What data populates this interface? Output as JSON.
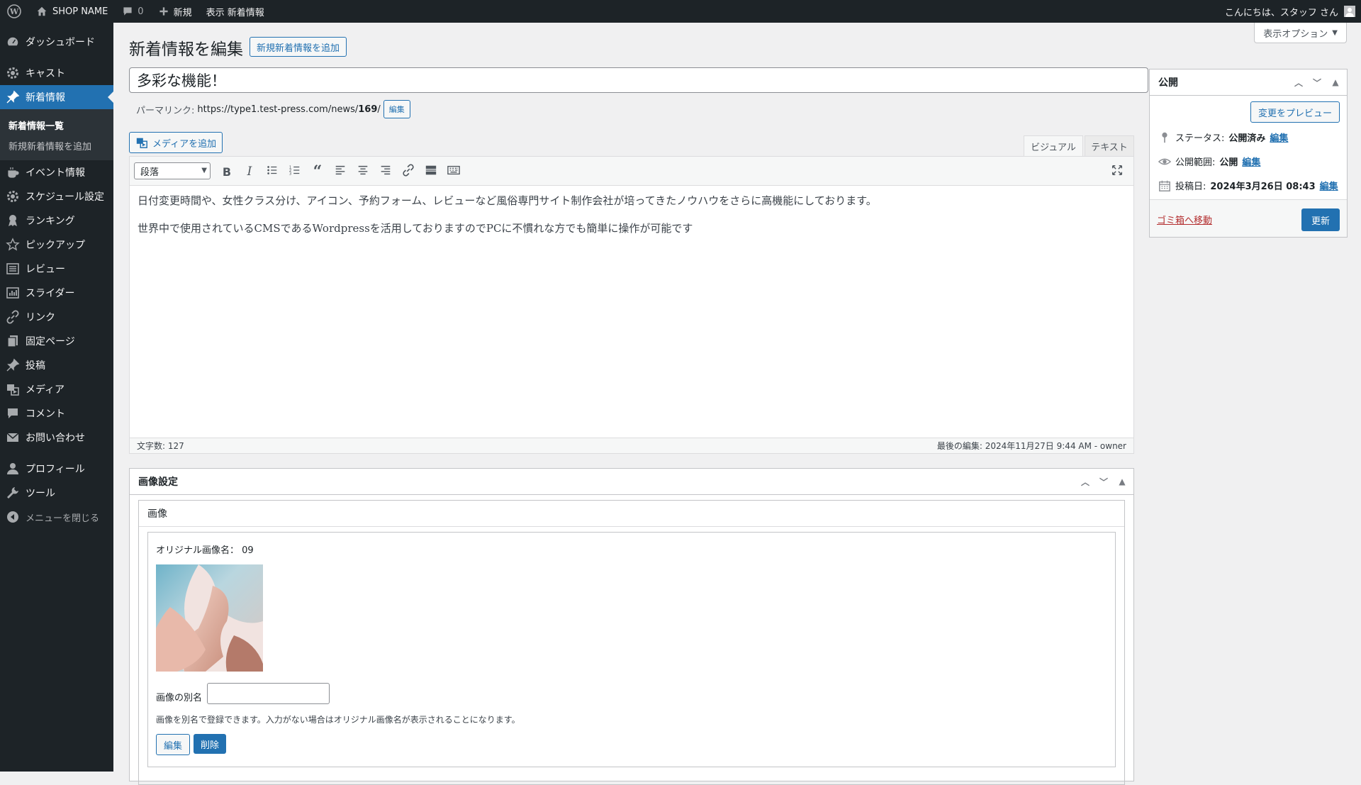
{
  "adminbar": {
    "site_name": "SHOP NAME",
    "comments_count": "0",
    "new_label": "新規",
    "view_label": "表示 新着情報",
    "greeting": "こんにちは、スタッフ さん"
  },
  "sidebar": {
    "items": [
      {
        "label": "ダッシュボード",
        "icon": "dashboard-icon"
      },
      {
        "label": "キャスト",
        "icon": "gear-icon"
      },
      {
        "label": "新着情報",
        "icon": "pin-icon"
      },
      {
        "label": "イベント情報",
        "icon": "coffee-icon"
      },
      {
        "label": "スケジュール設定",
        "icon": "gear-icon"
      },
      {
        "label": "ランキング",
        "icon": "award-icon"
      },
      {
        "label": "ピックアップ",
        "icon": "star-icon"
      },
      {
        "label": "レビュー",
        "icon": "list-icon"
      },
      {
        "label": "スライダー",
        "icon": "chart-icon"
      },
      {
        "label": "リンク",
        "icon": "link-icon"
      },
      {
        "label": "固定ページ",
        "icon": "page-icon"
      },
      {
        "label": "投稿",
        "icon": "pin-icon"
      },
      {
        "label": "メディア",
        "icon": "media-icon"
      },
      {
        "label": "コメント",
        "icon": "comment-icon"
      },
      {
        "label": "お問い合わせ",
        "icon": "mail-icon"
      },
      {
        "label": "プロフィール",
        "icon": "user-icon"
      },
      {
        "label": "ツール",
        "icon": "wrench-icon"
      }
    ],
    "submenu": [
      "新着情報一覧",
      "新規新着情報を追加"
    ],
    "collapse_label": "メニューを閉じる"
  },
  "screen_options": "表示オプション",
  "page": {
    "title": "新着情報を編集",
    "add_new": "新規新着情報を追加"
  },
  "post": {
    "title": "多彩な機能！",
    "permalink_label": "パーマリンク:",
    "permalink_base": "https://type1.test-press.com/news/",
    "permalink_slug": "169",
    "permalink_tail": "/",
    "permalink_edit": "編集"
  },
  "editor": {
    "add_media": "メディアを追加",
    "tab_visual": "ビジュアル",
    "tab_text": "テキスト",
    "format": "段落",
    "paragraphs": [
      "日付変更時間や、女性クラス分け、アイコン、予約フォーム、レビューなど風俗専門サイト制作会社が培ってきたノウハウをさらに高機能にしております。",
      "世界中で使用されているCMSであるWordpressを活用しておりますのでPCに不慣れな方でも簡単に操作が可能です"
    ],
    "word_count": "文字数: 127",
    "last_edited": "最後の編集: 2024年11月27日 9:44 AM - owner"
  },
  "publish": {
    "title": "公開",
    "preview": "変更をプレビュー",
    "status_label": "ステータス:",
    "status_value": "公開済み",
    "visibility_label": "公開範囲:",
    "visibility_value": "公開",
    "date_label": "投稿日:",
    "date_value": "2024年3月26日 08:43",
    "edit": "編集",
    "trash": "ゴミ箱へ移動",
    "update": "更新"
  },
  "image_settings": {
    "title": "画像設定",
    "subtitle": "画像",
    "original_name": "オリジナル画像名： 09",
    "alias_label": "画像の別名",
    "alias_value": "",
    "help": "画像を別名で登録できます。入力がない場合はオリジナル画像名が表示されることになります。",
    "edit": "編集",
    "delete": "削除"
  },
  "colors": {
    "accent": "#2271b1",
    "adminbar": "#1d2327",
    "danger": "#b32d2e"
  }
}
